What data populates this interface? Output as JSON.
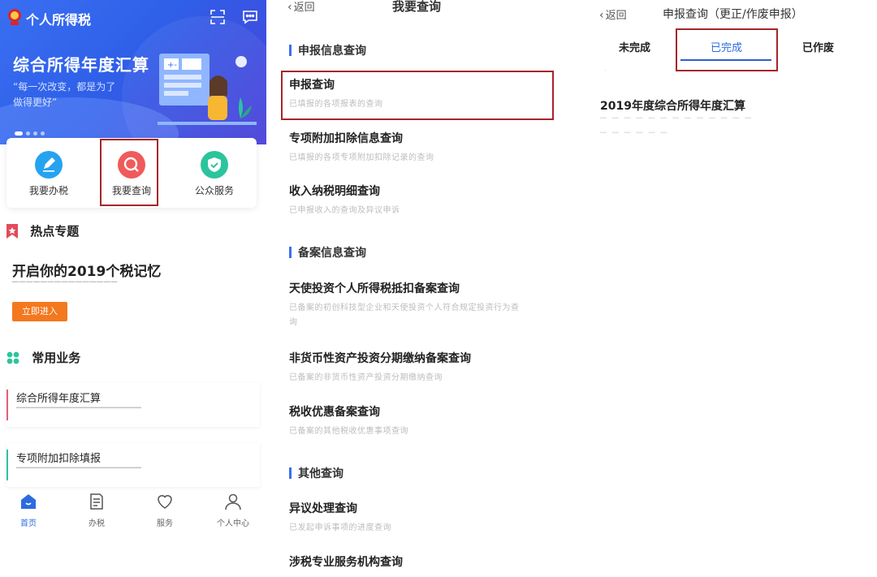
{
  "panel_home": {
    "app_title": "个人所得税",
    "banner": {
      "title": "综合所得年度汇算",
      "quote_line1": "“每一次改变，都是为了",
      "quote_line2": "做得更好”",
      "dot_count": 4
    },
    "quick_actions": [
      {
        "label": "我要办税",
        "icon": "pen-icon"
      },
      {
        "label": "我要查询",
        "icon": "search-icon",
        "highlighted": true
      },
      {
        "label": "公众服务",
        "icon": "shield-icon"
      }
    ],
    "hot_topics": {
      "heading": "热点专题",
      "title": "开启你的2019个税记忆",
      "button": "立即进入"
    },
    "common_services": {
      "heading": "常用业务",
      "items": [
        {
          "title": "综合所得年度汇算",
          "accent": "#e0607e"
        },
        {
          "title": "专项附加扣除填报",
          "accent": "#2cc49c"
        }
      ]
    },
    "tab_bar": [
      {
        "label": "首页",
        "icon": "home-icon",
        "active": true
      },
      {
        "label": "办税",
        "icon": "document-icon"
      },
      {
        "label": "服务",
        "icon": "heart-icon"
      },
      {
        "label": "个人中心",
        "icon": "person-icon"
      }
    ]
  },
  "panel_query": {
    "back_label": "返回",
    "title": "我要查询",
    "groups": [
      {
        "heading": "申报信息查询",
        "items": [
          {
            "title": "申报查询",
            "subtitle": "已填报的各项报表的查询",
            "highlighted": true
          },
          {
            "title": "专项附加扣除信息查询",
            "subtitle": "已填报的各项专项附加扣除记录的查询"
          },
          {
            "title": "收入纳税明细查询",
            "subtitle": "已申报收入的查询及异议申诉"
          }
        ]
      },
      {
        "heading": "备案信息查询",
        "items": [
          {
            "title": "天使投资个人所得税抵扣备案查询",
            "subtitle_line1": "已备案的初创科技型企业和天使投资个人符合规定投资行为查",
            "subtitle_line2": "询"
          },
          {
            "title": "非货币性资产投资分期缴纳备案查询",
            "subtitle": "已备案的非货币性资产投资分期缴纳查询"
          },
          {
            "title": "税收优惠备案查询",
            "subtitle": "已备案的其他税收优惠事项查询"
          }
        ]
      },
      {
        "heading": "其他查询",
        "items": [
          {
            "title": "异议处理查询",
            "subtitle": "已发起申诉事项的进度查询"
          },
          {
            "title": "涉税专业服务机构查询"
          }
        ]
      }
    ]
  },
  "panel_result": {
    "back_label": "返回",
    "title": "申报查询（更正/作废申报）",
    "tabs": [
      {
        "label": "未完成"
      },
      {
        "label": "已完成",
        "active": true,
        "highlighted": true
      },
      {
        "label": "已作废"
      }
    ],
    "record_title": "2019年度综合所得年度汇算"
  },
  "colors": {
    "brand_blue": "#2d6be0",
    "highlight_border": "#a6252a",
    "button_orange": "#f4781e"
  }
}
